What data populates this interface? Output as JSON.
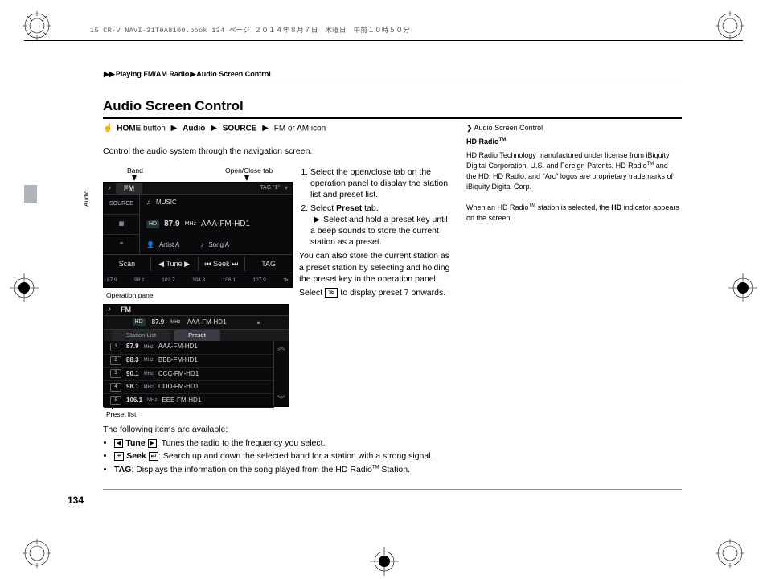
{
  "file_header": "15 CR-V NAVI-31T0A8100.book  134 ページ  ２０１４年８月７日　木曜日　午前１０時５０分",
  "breadcrumb": {
    "sep": "▶▶",
    "a": "Playing FM/AM Radio",
    "b": "Audio Screen Control"
  },
  "title": "Audio Screen Control",
  "nav": {
    "home": "HOME",
    "home_suffix": " button",
    "audio": "Audio",
    "source": "SOURCE",
    "tail": "FM or AM icon"
  },
  "side_label": "Audio",
  "intro": "Control the audio system through the navigation screen.",
  "callouts": {
    "band": "Band",
    "open_close": "Open/Close tab",
    "op_panel": "Operation panel",
    "preset_list": "Preset list"
  },
  "shot1": {
    "band_label": "FM",
    "tag": "TAG \"1\"",
    "source": "SOURCE",
    "music": "MUSIC",
    "hd": "HD",
    "freq": "87.9",
    "mhz": "MHz",
    "station": "AAA-FM-HD1",
    "artist": "Artist A",
    "song": "Song A",
    "buttons": {
      "scan": "Scan",
      "tune": "Tune",
      "seek": "Seek",
      "tag": "TAG"
    },
    "presets": [
      "87.9",
      "98.1",
      "102.7",
      "104.3",
      "106.1",
      "107.9"
    ]
  },
  "shot2": {
    "band": "FM",
    "hd": "HD",
    "freq": "87.9",
    "mhz": "MHz",
    "station": "AAA-FM-HD1",
    "tabs": {
      "station_list": "Station List",
      "preset": "Preset"
    },
    "rows": [
      {
        "n": "1",
        "f": "87.9",
        "name": "AAA-FM-HD1"
      },
      {
        "n": "2",
        "f": "88.3",
        "name": "BBB-FM-HD1"
      },
      {
        "n": "3",
        "f": "90.1",
        "name": "CCC-FM-HD1"
      },
      {
        "n": "4",
        "f": "98.1",
        "name": "DDD-FM-HD1"
      },
      {
        "n": "5",
        "f": "106.1",
        "name": "EEE-FM-HD1"
      }
    ]
  },
  "instr": {
    "step1": "Select the open/close tab on the operation panel to display the station list and preset list.",
    "step2_a": "Select ",
    "step2_b": "Preset",
    "step2_c": " tab.",
    "step2_sub": "Select and hold a preset key until a beep sounds to store the current station as a preset.",
    "para1": "You can also store the current station as a preset station by selecting and holding the preset key in the operation panel.",
    "para2_a": "Select ",
    "para2_b": " to display preset 7 onwards.",
    "icon": "≫"
  },
  "sidebar": {
    "title": "Audio Screen Control",
    "h": "HD Radio",
    "tm": "TM",
    "p1": "HD Radio Technology manufactured under license from iBiquity Digital Corporation. U.S. and Foreign Patents. HD Radio",
    "p1b": " and the HD, HD Radio, and \"Arc\" logos are proprietary trademarks of iBiquity Digital Corp.",
    "p2a": "When an HD Radio",
    "p2b": " station is selected, the ",
    "p2c": "HD",
    "p2d": " indicator appears on the screen."
  },
  "bottom": {
    "intro": "The following items are available:",
    "tune_lbl": "Tune",
    "tune_txt": ": Tunes the radio to the frequency you select.",
    "seek_lbl": "Seek",
    "seek_txt": ": Search up and down the selected band for a station with a strong signal.",
    "tag_lbl": "TAG",
    "tag_txt": ": Displays the information on the song played from the HD Radio",
    "tag_txt2": " Station."
  },
  "page_number": "134"
}
